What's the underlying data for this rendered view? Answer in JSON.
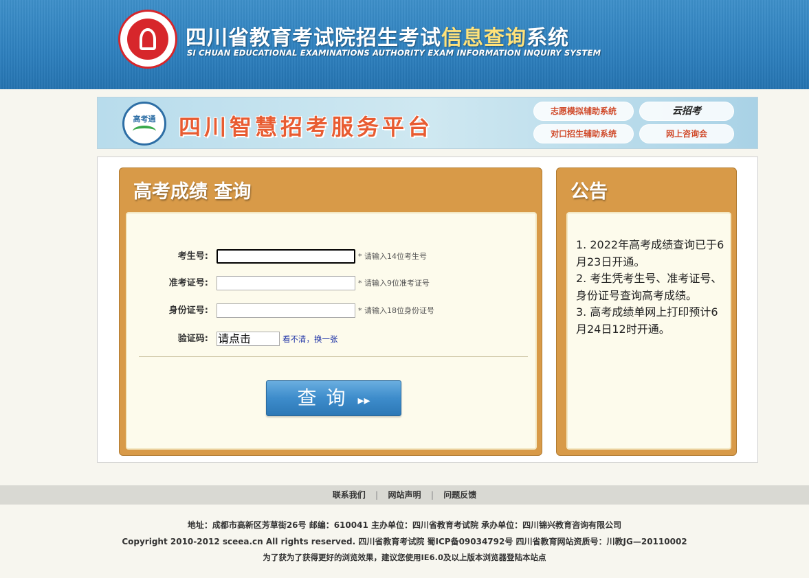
{
  "header": {
    "title_part1": "四川省教育考试院招生考试",
    "title_highlight": "信息查询",
    "title_part2": "系统",
    "subtitle": "SI CHUAN EDUCATIONAL EXAMINATIONS AUTHORITY EXAM INFORMATION INQUIRY SYSTEM",
    "seal_icon": "seal-logo-icon",
    "seal_color": "#d7262b",
    "accent_color": "#ffe27a"
  },
  "banner": {
    "logo_text": "高考通",
    "title": "四川智慧招考服务平台",
    "buttons": [
      {
        "label": "志愿模拟辅助系统"
      },
      {
        "label": "云招考"
      },
      {
        "label": "对口招生辅助系统"
      },
      {
        "label": "网上咨询会"
      }
    ]
  },
  "query_panel": {
    "title": "高考成绩  查询",
    "fields": [
      {
        "label": "考生号:",
        "value": "",
        "hint": "* 请输入14位考生号"
      },
      {
        "label": "准考证号:",
        "value": "",
        "hint": "* 请输入9位准考证号"
      },
      {
        "label": "身份证号:",
        "value": "",
        "hint": "* 请输入18位身份证号"
      }
    ],
    "captcha": {
      "label": "验证码:",
      "box_text": "请点击",
      "refresh_link": "看不清，换一张"
    },
    "submit_label": "查询",
    "submit_arrow": "▸▸",
    "panel_color": "#d89a48",
    "button_color": "#3d8ccb"
  },
  "notice_panel": {
    "title": "公告",
    "items": [
      "1. 2022年高考成绩查询已于6月23日开通。",
      "2. 考生凭考生号、准考证号、身份证号查询高考成绩。",
      "3. 高考成绩单网上打印预计6月24日12时开通。"
    ]
  },
  "footer": {
    "links": [
      "联系我们",
      "网站声明",
      "问题反馈"
    ],
    "address_line": "地址：成都市高新区芳草街26号 邮编：610041      主办单位：四川省教育考试院 承办单位：四川锦兴教育咨询有限公司",
    "copyright_line": "Copyright 2010-2012 sceea.cn All rights reserved. 四川省教育考试院      蜀ICP备09034792号 四川省教育网站资质号：川教JG—20110002",
    "browser_line": "为了获为了获得更好的浏览效果，建议您使用IE6.0及以上版本浏览器登陆本站点"
  }
}
